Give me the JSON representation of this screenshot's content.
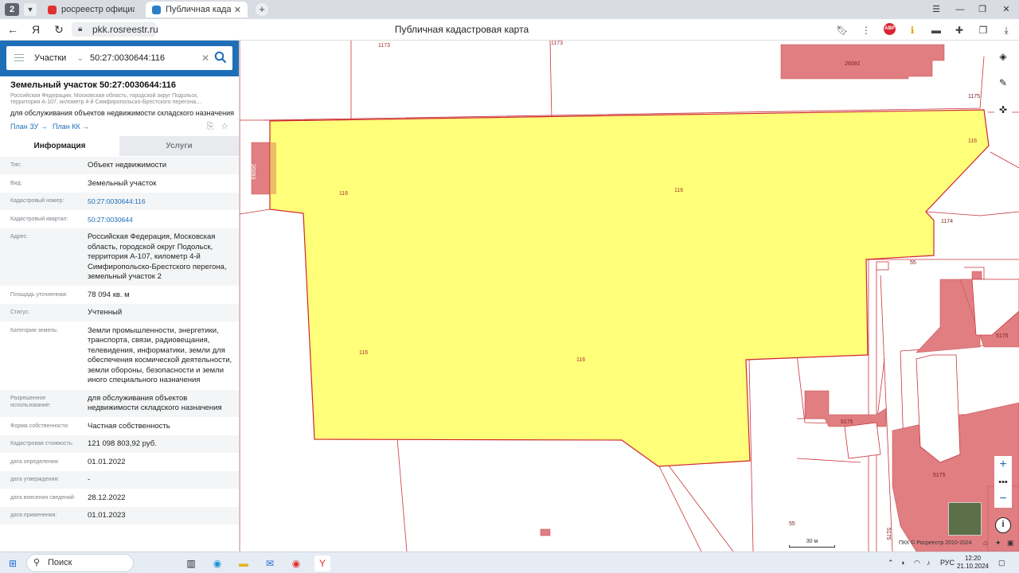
{
  "browser": {
    "tab_count": "2",
    "tabs": [
      {
        "title": "росреестр официальный"
      },
      {
        "title": "Публичная кадастровая"
      }
    ],
    "url": "pkk.rosreestr.ru",
    "page_title": "Публичная кадастровая карта",
    "abp_label": "ABP"
  },
  "search": {
    "category": "Участки",
    "query": "50:27:0030644:116"
  },
  "object": {
    "title": "Земельный участок 50:27:0030644:116",
    "address_short": "Российская Федерация, Московская область, городской округ Подольск, территория А-107, километр 4-й Симфиропольско-Брестского перегона,...",
    "purpose": "для обслуживания объектов недвижимости складского назначения",
    "plan_zu": "План ЗУ →",
    "plan_kk": "План КК →"
  },
  "info_tabs": {
    "info": "Информация",
    "services": "Услуги"
  },
  "properties": [
    {
      "key": "Тип:",
      "value": "Объект недвижимости"
    },
    {
      "key": "Вид:",
      "value": "Земельный участок"
    },
    {
      "key": "Кадастровый номер:",
      "value": "50:27:0030644:116",
      "link": true
    },
    {
      "key": "Кадастровый квартал:",
      "value": "50:27:0030644",
      "link": true
    },
    {
      "key": "Адрес:",
      "value": "Российская Федерация, Московская область, городской округ Подольск, территория А-107, километр 4-й Симфиропольско-Брестского перегона, земельный участок 2"
    },
    {
      "key": "Площадь уточненная:",
      "value": "78 094 кв. м"
    },
    {
      "key": "Статус:",
      "value": "Учтенный"
    },
    {
      "key": "Категория земель:",
      "value": "Земли промышленности, энергетики, транспорта, связи, радиовещания, телевидения, информатики, земли для обеспечения космической деятельности, земли обороны, безопасности и земли иного специального назначения"
    },
    {
      "key": "Разрешенное использование:",
      "value": "для обслуживания объектов недвижимости складского назначения"
    },
    {
      "key": "Форма собственности:",
      "value": "Частная собственность"
    },
    {
      "key": "Кадастровая стоимость:",
      "value": "121 098 803,92 руб."
    },
    {
      "key": "дата определения:",
      "value": "01.01.2022"
    },
    {
      "key": "дата утверждения:",
      "value": "-"
    },
    {
      "key": "дата внесения сведений:",
      "value": "28.12.2022"
    },
    {
      "key": "дата применения:",
      "value": "01.01.2023"
    }
  ],
  "map": {
    "labels": {
      "n1173a": "1173",
      "n1173b": "1173",
      "n26091": "26091",
      "n1175": "1175",
      "n116_right": "116",
      "n116_a": "116",
      "n116_b": "116",
      "n116_c": "116",
      "n116_d": "116",
      "n1174": "1174",
      "n26093": "26093",
      "n55a": "55",
      "n55b": "55",
      "n5175a": "5175",
      "n5175b": "5175",
      "n5175c": "5175",
      "n5175d": "5175"
    },
    "scale": "30 м",
    "copyright": "ПКК © Росреестр 2010-2024",
    "colors": {
      "parcel_fill": "#ffff7a",
      "parcel_border": "#d0262f",
      "building_fill": "#e07e82",
      "boundary": "#c9343c"
    }
  },
  "taskbar": {
    "search_label": "Поиск",
    "lang": "РУС",
    "time": "12:20",
    "date": "21.10.2024"
  }
}
